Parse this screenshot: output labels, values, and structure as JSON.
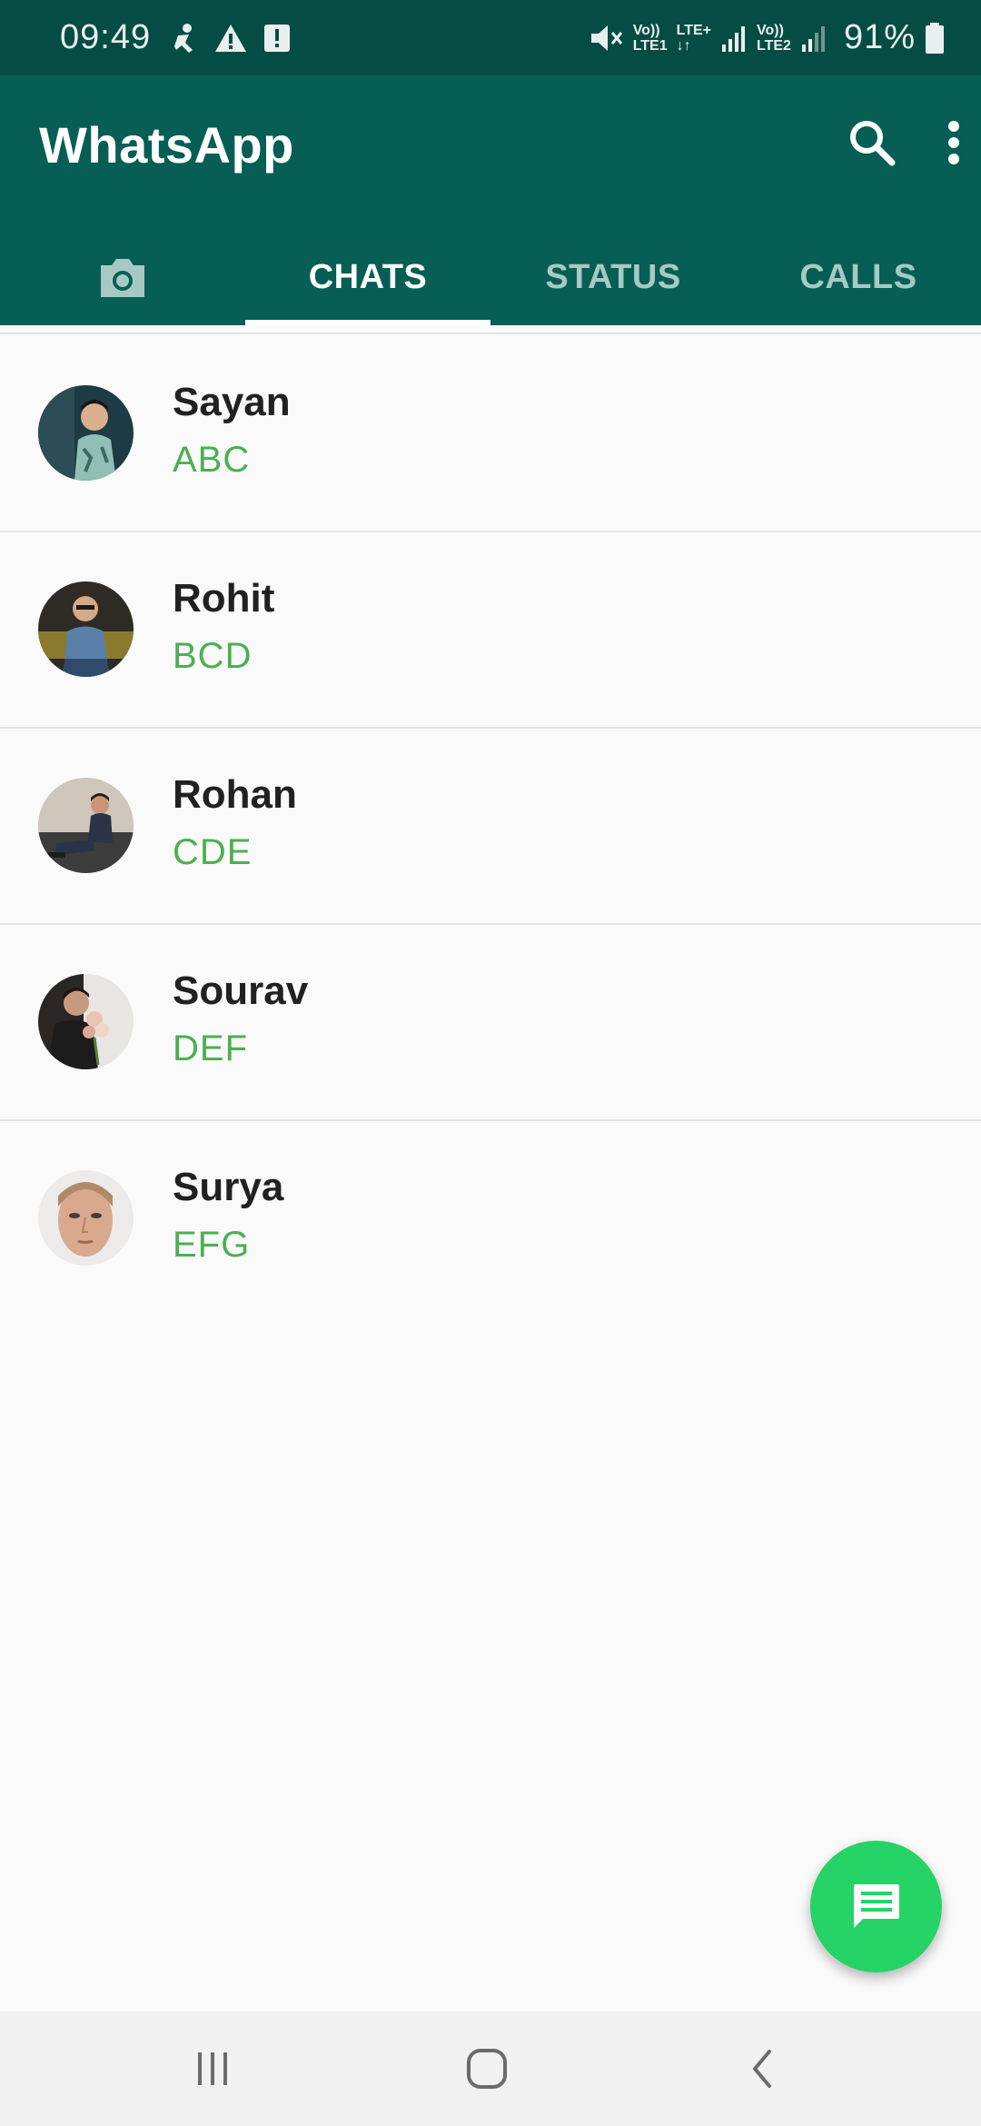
{
  "status_bar": {
    "time": "09:49",
    "sim1_top": "Vo))",
    "sim1_bottom": "LTE1",
    "data_top": "LTE+",
    "data_bottom": "↓↑",
    "sim2_top": "Vo))",
    "sim2_bottom": "LTE2",
    "battery": "91%"
  },
  "app_bar": {
    "title": "WhatsApp",
    "icons": [
      "search-icon",
      "more-vert-icon"
    ]
  },
  "tabs": [
    {
      "label": "",
      "icon": "camera-icon",
      "selected": false
    },
    {
      "label": "CHATS",
      "selected": true
    },
    {
      "label": "STATUS",
      "selected": false
    },
    {
      "label": "CALLS",
      "selected": false
    }
  ],
  "chats": [
    {
      "name": "Sayan",
      "message": "ABC"
    },
    {
      "name": "Rohit",
      "message": "BCD"
    },
    {
      "name": "Rohan",
      "message": "CDE"
    },
    {
      "name": "Sourav",
      "message": "DEF"
    },
    {
      "name": "Surya",
      "message": "EFG"
    }
  ],
  "fab": {
    "icon": "new-chat-icon"
  },
  "nav_bar": {
    "icons": [
      "recent-apps-icon",
      "home-icon",
      "back-icon"
    ]
  },
  "colors": {
    "status_bar": "#054d44",
    "app_bar": "#075e54",
    "accent_green": "#25d366",
    "message_green": "#4caf50"
  }
}
